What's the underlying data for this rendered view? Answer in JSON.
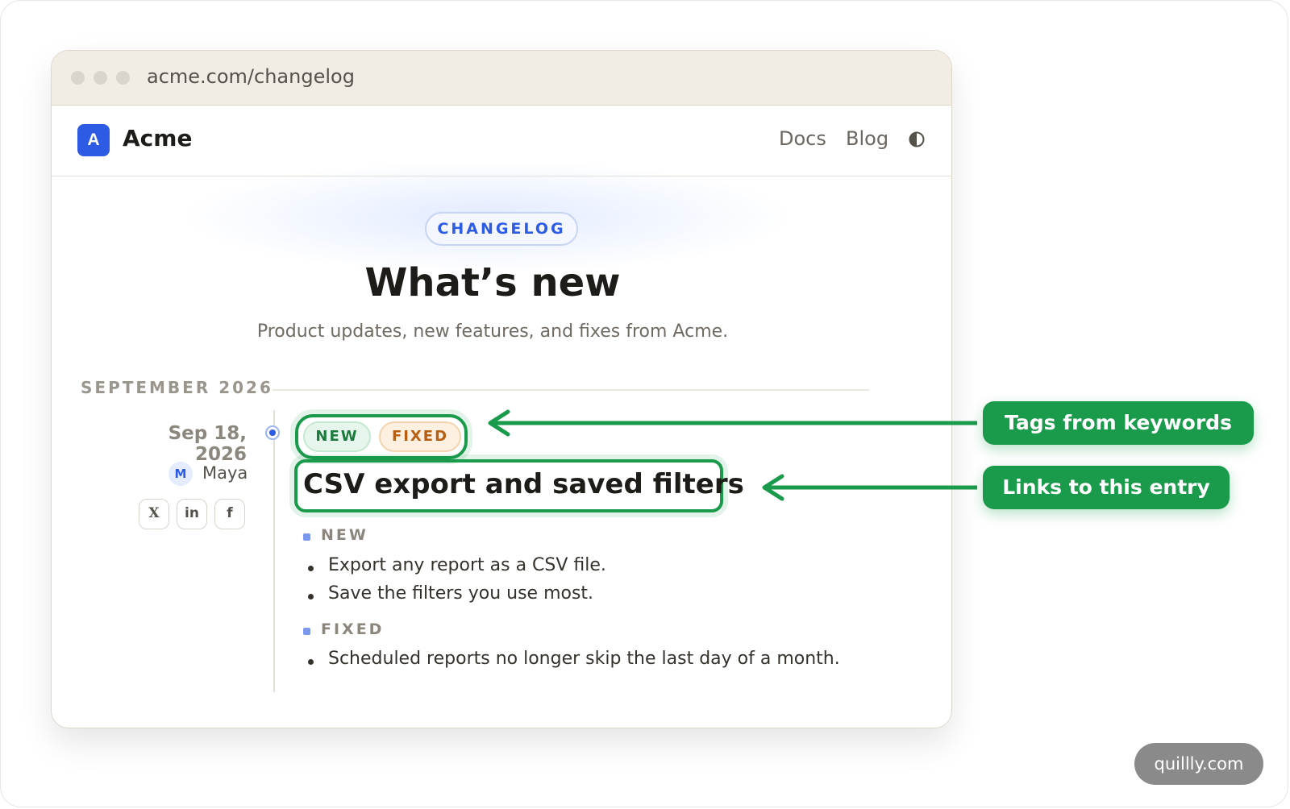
{
  "browser": {
    "url": "acme.com/changelog"
  },
  "site": {
    "logo_letter": "A",
    "brand": "Acme",
    "nav": {
      "docs": "Docs",
      "blog": "Blog"
    }
  },
  "hero": {
    "pill": "CHANGELOG",
    "headline": "What’s new",
    "subtitle": "Product updates, new features, and fixes from Acme."
  },
  "month": "SEPTEMBER 2026",
  "entry": {
    "date": "Sep 18, 2026",
    "author_initial": "M",
    "author": "Maya",
    "share": {
      "x": "X",
      "linkedin": "in",
      "facebook": "f"
    },
    "tags": {
      "new": "NEW",
      "fixed": "FIXED"
    },
    "title": "CSV export and saved filters",
    "sections": [
      {
        "heading": "NEW",
        "items": [
          "Export any report as a CSV file.",
          "Save the filters you use most."
        ]
      },
      {
        "heading": "FIXED",
        "items": [
          "Scheduled reports no longer skip the last day of a month."
        ]
      }
    ]
  },
  "callouts": {
    "tags": "Tags from keywords",
    "links": "Links to this entry"
  },
  "watermark": "quillly.com",
  "colors": {
    "accent_blue": "#2d5be3",
    "callout_green": "#1a9a4b",
    "tag_new": "#1c7a3f",
    "tag_fixed": "#b85e12"
  }
}
